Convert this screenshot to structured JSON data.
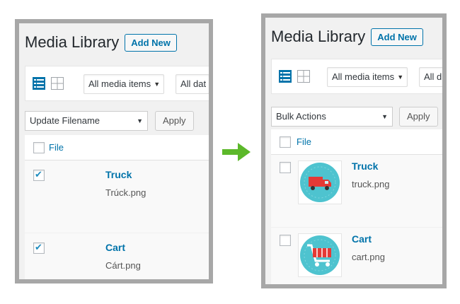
{
  "before": {
    "title": "Media Library",
    "add_new": "Add New",
    "filter_type": "All media items",
    "filter_date": "All dat",
    "bulk_action": "Update Filename",
    "apply": "Apply",
    "column_file": "File",
    "rows": [
      {
        "title": "Truck",
        "filename": "Trúck.png",
        "checked": true
      },
      {
        "title": "Cart",
        "filename": "Cárt.png",
        "checked": true
      }
    ]
  },
  "after": {
    "title": "Media Library",
    "add_new": "Add New",
    "filter_type": "All media items",
    "filter_date": "All d",
    "bulk_action": "Bulk Actions",
    "apply": "Apply",
    "column_file": "File",
    "rows": [
      {
        "title": "Truck",
        "filename": "truck.png",
        "checked": false,
        "thumb_icon": "truck-icon"
      },
      {
        "title": "Cart",
        "filename": "cart.png",
        "checked": false,
        "thumb_icon": "shopping-cart-icon"
      }
    ]
  },
  "colors": {
    "link": "#0073aa",
    "arrow": "#5cb82a",
    "thumb_bg": "#4ec3cf",
    "icon_red": "#e53935",
    "panel_border": "#a7a7a7"
  }
}
